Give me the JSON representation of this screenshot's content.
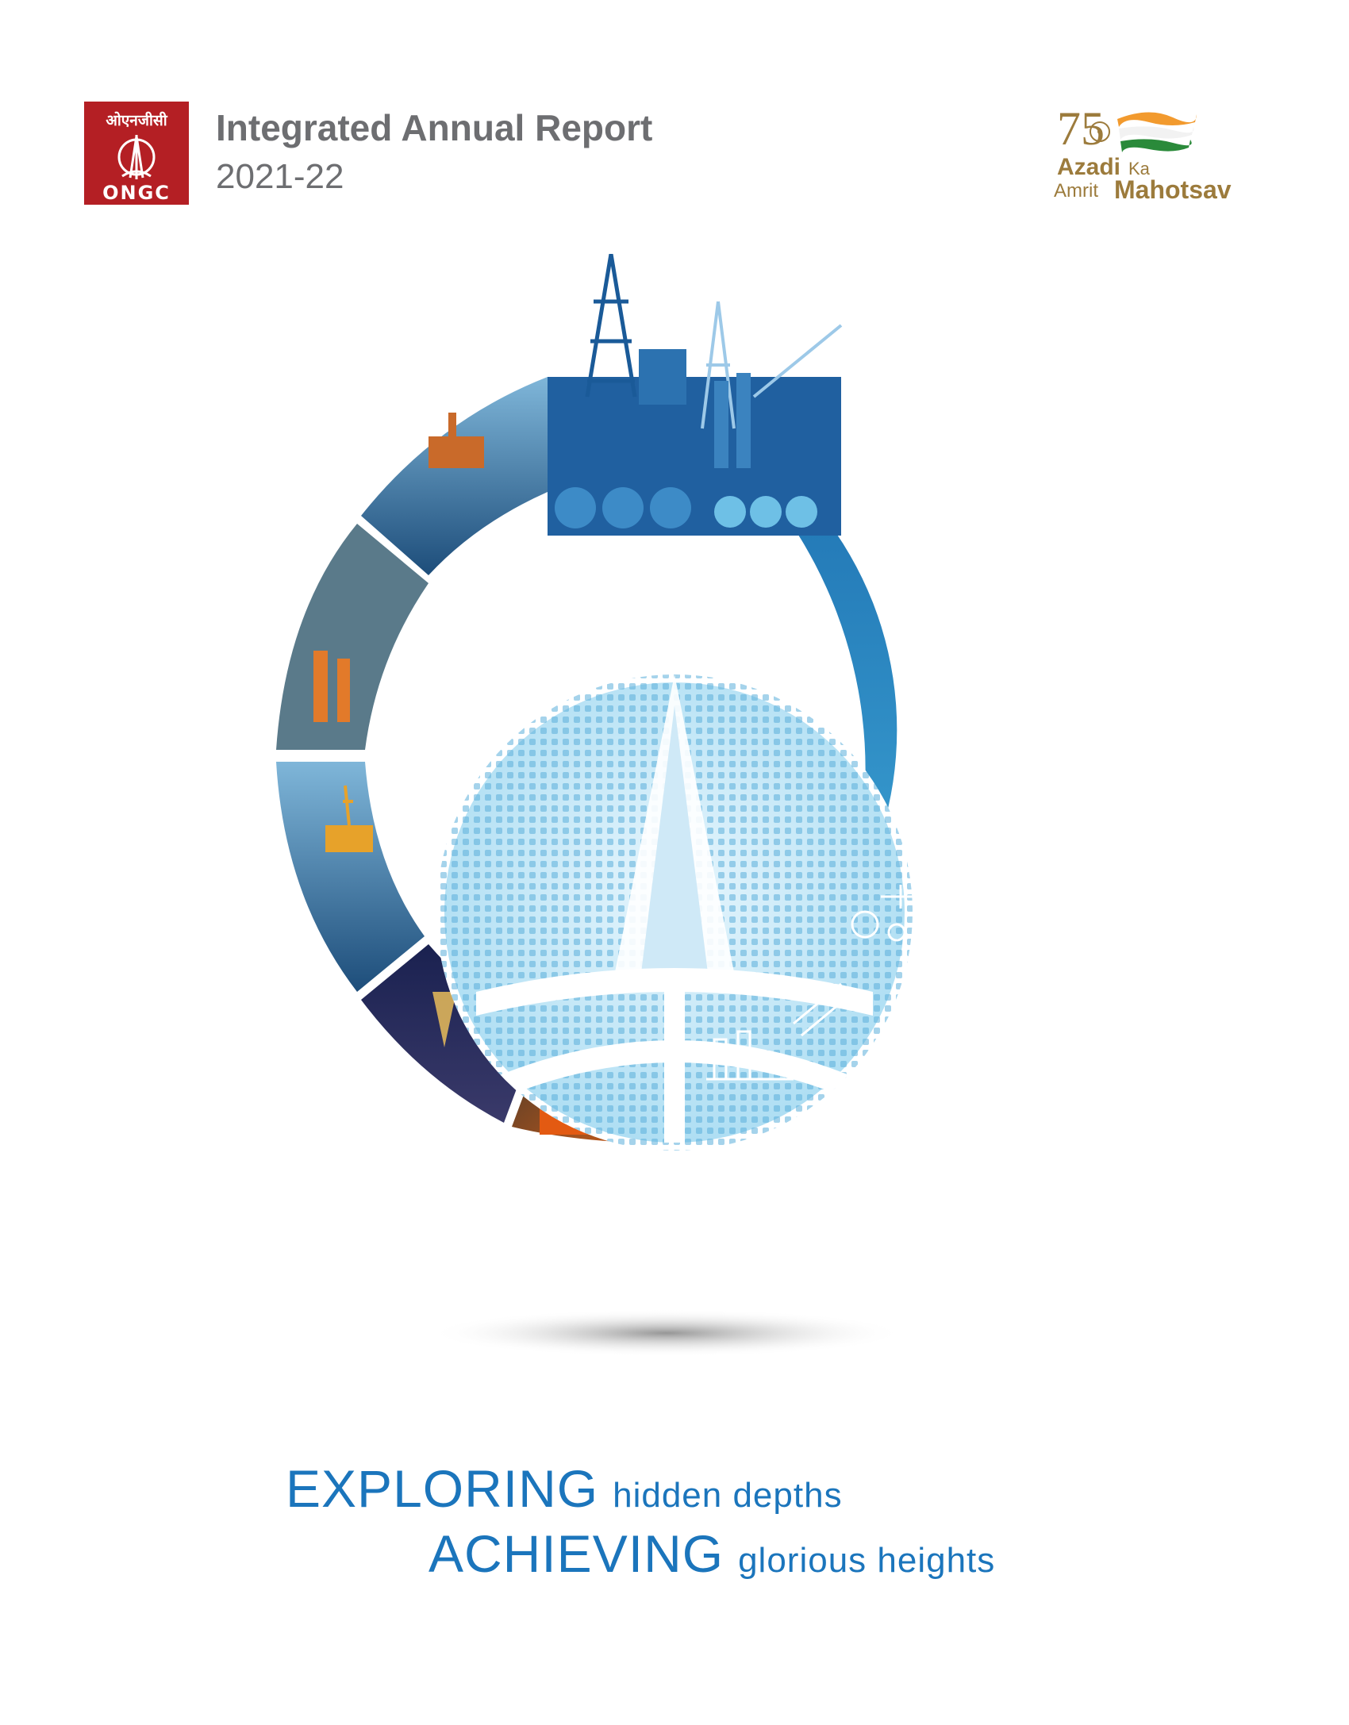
{
  "header": {
    "logo_hindi": "ओएनजीसी",
    "logo_name": "ONGC",
    "title": "Integrated Annual Report",
    "year": "2021-22"
  },
  "akam_logo": {
    "number": "75",
    "word_azadi": "Azadi",
    "word_ka": "Ka",
    "word_amrit": "Amrit",
    "word_mahotsav": "Mahotsav"
  },
  "tagline": {
    "line1_big": "EXPLORING",
    "line1_small": "hidden depths",
    "line2_big": "ACHIEVING",
    "line2_small": "glorious heights"
  },
  "colors": {
    "ongc_red": "#b41f24",
    "title_grey": "#6d6e71",
    "accent_blue": "#1b75bc",
    "ring_blue": "#2b8fcb",
    "akam_gold": "#9c7b3c",
    "saffron": "#f29a2e",
    "india_green": "#2a8a3a"
  },
  "icons": [
    "ongc-emblem-icon",
    "flag-icon",
    "chakra-icon",
    "drilling-rig-icon",
    "wind-turbine-icon",
    "solar-panel-icon",
    "pump-jack-icon",
    "offshore-platform-icon",
    "gear-icon",
    "fuel-pump-icon",
    "tanker-truck-icon",
    "cargo-ship-icon",
    "engineer-icon",
    "pipeline-valve-icon",
    "refinery-icon"
  ]
}
